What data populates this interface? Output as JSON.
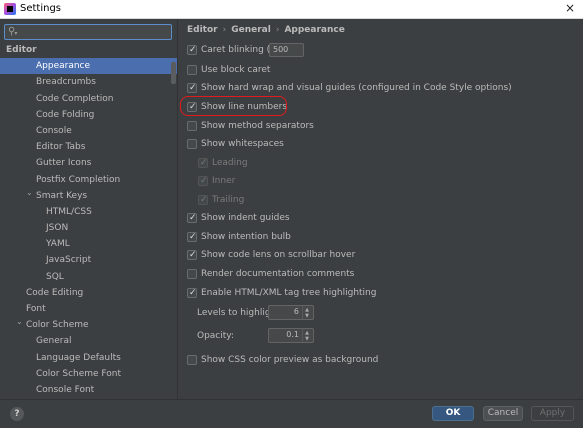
{
  "window": {
    "title": "Settings",
    "close_glyph": "×"
  },
  "search": {
    "placeholder": "",
    "value": ""
  },
  "tree": [
    {
      "label": "Editor",
      "indent": 0,
      "bold": true,
      "selected": false
    },
    {
      "label": "Appearance",
      "indent": 3,
      "bold": false,
      "selected": true
    },
    {
      "label": "Breadcrumbs",
      "indent": 3,
      "bold": false,
      "selected": false
    },
    {
      "label": "Code Completion",
      "indent": 3,
      "bold": false,
      "selected": false
    },
    {
      "label": "Code Folding",
      "indent": 3,
      "bold": false,
      "selected": false
    },
    {
      "label": "Console",
      "indent": 3,
      "bold": false,
      "selected": false
    },
    {
      "label": "Editor Tabs",
      "indent": 3,
      "bold": false,
      "selected": false
    },
    {
      "label": "Gutter Icons",
      "indent": 3,
      "bold": false,
      "selected": false
    },
    {
      "label": "Postfix Completion",
      "indent": 3,
      "bold": false,
      "selected": false
    },
    {
      "label": "Smart Keys",
      "indent": 3,
      "bold": false,
      "selected": false,
      "expanded": true
    },
    {
      "label": "HTML/CSS",
      "indent": 4,
      "bold": false,
      "selected": false
    },
    {
      "label": "JSON",
      "indent": 4,
      "bold": false,
      "selected": false
    },
    {
      "label": "YAML",
      "indent": 4,
      "bold": false,
      "selected": false
    },
    {
      "label": "JavaScript",
      "indent": 4,
      "bold": false,
      "selected": false
    },
    {
      "label": "SQL",
      "indent": 4,
      "bold": false,
      "selected": false
    },
    {
      "label": "Code Editing",
      "indent": 2,
      "bold": false,
      "selected": false
    },
    {
      "label": "Font",
      "indent": 2,
      "bold": false,
      "selected": false
    },
    {
      "label": "Color Scheme",
      "indent": 2,
      "bold": false,
      "selected": false,
      "expanded": true
    },
    {
      "label": "General",
      "indent": 3,
      "bold": false,
      "selected": false
    },
    {
      "label": "Language Defaults",
      "indent": 3,
      "bold": false,
      "selected": false
    },
    {
      "label": "Color Scheme Font",
      "indent": 3,
      "bold": false,
      "selected": false
    },
    {
      "label": "Console Font",
      "indent": 3,
      "bold": false,
      "selected": false
    }
  ],
  "breadcrumb": {
    "part1": "Editor",
    "part2": "General",
    "part3": "Appearance",
    "sep": "›"
  },
  "options": {
    "caret_blinking": {
      "label": "Caret blinking (ms):",
      "checked": true,
      "value": "500"
    },
    "block_caret": {
      "label": "Use block caret",
      "checked": false
    },
    "hard_wrap": {
      "label": "Show hard wrap and visual guides (configured in Code Style options)",
      "checked": true
    },
    "line_numbers": {
      "label": "Show line numbers",
      "checked": true
    },
    "method_separators": {
      "label": "Show method separators",
      "checked": false
    },
    "whitespaces": {
      "label": "Show whitespaces",
      "checked": false
    },
    "leading": {
      "label": "Leading",
      "checked": true,
      "disabled": true
    },
    "inner": {
      "label": "Inner",
      "checked": true,
      "disabled": true
    },
    "trailing": {
      "label": "Trailing",
      "checked": true,
      "disabled": true
    },
    "indent_guides": {
      "label": "Show indent guides",
      "checked": true
    },
    "intention_bulb": {
      "label": "Show intention bulb",
      "checked": true
    },
    "code_lens": {
      "label": "Show code lens on scrollbar hover",
      "checked": true
    },
    "render_docs": {
      "label": "Render documentation comments",
      "checked": false
    },
    "tag_tree": {
      "label": "Enable HTML/XML tag tree highlighting",
      "checked": true
    },
    "levels": {
      "label": "Levels to highlight:",
      "value": "6"
    },
    "opacity": {
      "label": "Opacity:",
      "value": "0.1"
    },
    "css_preview": {
      "label": "Show CSS color preview as background",
      "checked": false
    }
  },
  "buttons": {
    "help": "?",
    "ok": "OK",
    "cancel": "Cancel",
    "apply": "Apply"
  },
  "colors": {
    "selection": "#4b6eaf",
    "background": "#3c3f41",
    "ok_button": "#365880",
    "annotation_ring": "#e01b1b"
  },
  "icons": {
    "app": "intellij-app-icon",
    "search": "search-icon",
    "chevron": "chevron-down-icon"
  }
}
